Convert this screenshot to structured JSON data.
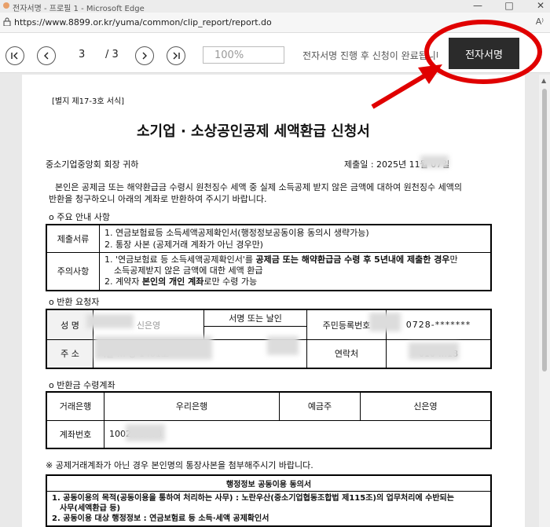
{
  "window": {
    "title": "전자서명 - 프로필 1 - Microsoft Edge",
    "min": "—",
    "max": "□",
    "close": "✕"
  },
  "address": {
    "url": "https://www.8899.or.kr/yuma/common/clip_report/report.do",
    "reader": "A⁾"
  },
  "toolbar": {
    "current_page": "3",
    "total_pages": "/ 3",
    "zoom": "100%",
    "notice": "전자서명 진행 후 신청이 완료됩니다",
    "sign_label": "전자서명"
  },
  "doc": {
    "form_no": "[별지 제17-3호 서식]",
    "title": "소기업 · 소상공인공제 세액환급 신청서",
    "addressee": "중소기업중앙회 회장  귀하",
    "submit_date_label": "제출일 :  2025년 11월 07일",
    "intro_1": "본인은 공제금 또는 해약환급금 수령시 원천징수 세액 중 실제 소득공제 받지 않은 금액에 대하여 원천징수 세액의",
    "intro_2": "반환을 청구하오니 아래의 계좌로 반환하여 주시기 바랍니다.",
    "sec1": "o  주요 안내 사항",
    "docs_label": "제출서류",
    "docs_1": "1. 연금보험료등 소득세액공제확인서(행정정보공동이용 동의시 생략가능)",
    "docs_2": "2. 통장 사본 (공제거래 계좌가 아닌 경우만)",
    "caution_label": "주의사항",
    "caution_1a": "1. '연금보험료 등 소득세액공제확인서'를 ",
    "caution_1b": "공제금 또는 해약환급금 수령 후 5년내에 제출한 경우",
    "caution_1c": "만",
    "caution_2": "소득공제받지 않은 금액에 대한 세액 환급",
    "caution_3a": "2. 계약자 ",
    "caution_3b": "본인의 개인 계좌",
    "caution_3c": "로만 수령 가능",
    "sec2": "o  반환 요청자",
    "name_label": "성 명",
    "name_value": "신은영",
    "sign_label": "서명 또는 날인",
    "rrn_label": "주민등록번호",
    "rrn_value": "0728-*******",
    "addr_label": "주 소",
    "addr_value": "서울 … 동 1401호",
    "phone_label": "연락처",
    "phone_value": "010-…18",
    "sec3": "o  반환금 수령계좌",
    "bank_label": "거래은행",
    "bank_value": "우리은행",
    "holder_label": "예금주",
    "holder_value": "신은영",
    "acct_label": "계좌번호",
    "acct_value": "1002…3588",
    "note": "※ 공제거래계좌가 아닌 경우 본인명의 통장사본을 첨부해주시기 바랍니다.",
    "consent_title": "행정정보 공동이용 동의서",
    "consent_1": "1. 공동이용의 목적(공동이용을 통하여 처리하는 사무) : 노란우산(중소기업협동조합법 제115조)의 업무처리에 수반되는",
    "consent_1b": "사무(세액환급 등)",
    "consent_2": "2. 공동이용 대상 행정정보 : 연금보험료 등 소득·세액 공제확인서"
  },
  "colors": {
    "annotation": "#e00000",
    "sign_button": "#2b2b2b"
  }
}
